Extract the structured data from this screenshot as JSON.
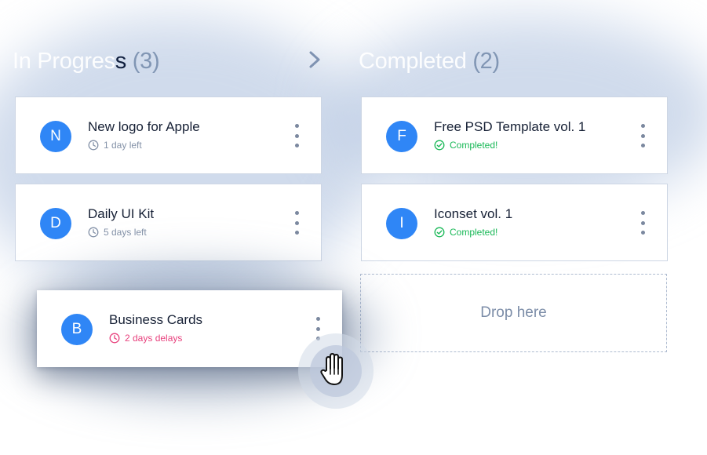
{
  "board": {
    "in_progress": {
      "title_faded": "In Progres",
      "title_dark": "s",
      "count": "(3)",
      "cards": [
        {
          "initial": "N",
          "title": "New logo for Apple",
          "meta": "1 day left",
          "status": "pending"
        },
        {
          "initial": "D",
          "title": "Daily UI Kit",
          "meta": "5 days left",
          "status": "pending"
        }
      ]
    },
    "dragging_card": {
      "initial": "B",
      "title": "Business Cards",
      "meta": "2 days delays",
      "status": "delayed"
    },
    "completed": {
      "title": "Completed",
      "count": "(2)",
      "cards": [
        {
          "initial": "F",
          "title": "Free PSD Template vol. 1",
          "meta": "Completed!",
          "status": "completed"
        },
        {
          "initial": "I",
          "title": "Iconset vol. 1",
          "meta": "Completed!",
          "status": "completed"
        }
      ],
      "drop_label": "Drop here"
    }
  },
  "icons": {
    "arrow": "chevron-right-icon",
    "menu": "more-vertical-icon",
    "clock": "clock-icon",
    "check": "check-circle-icon",
    "cursor": "hand-grab-icon"
  },
  "colors": {
    "avatar": "#2f86f6",
    "completed": "#18b856",
    "delayed": "#e8417d",
    "muted": "#8492a8",
    "title": "#162035"
  }
}
